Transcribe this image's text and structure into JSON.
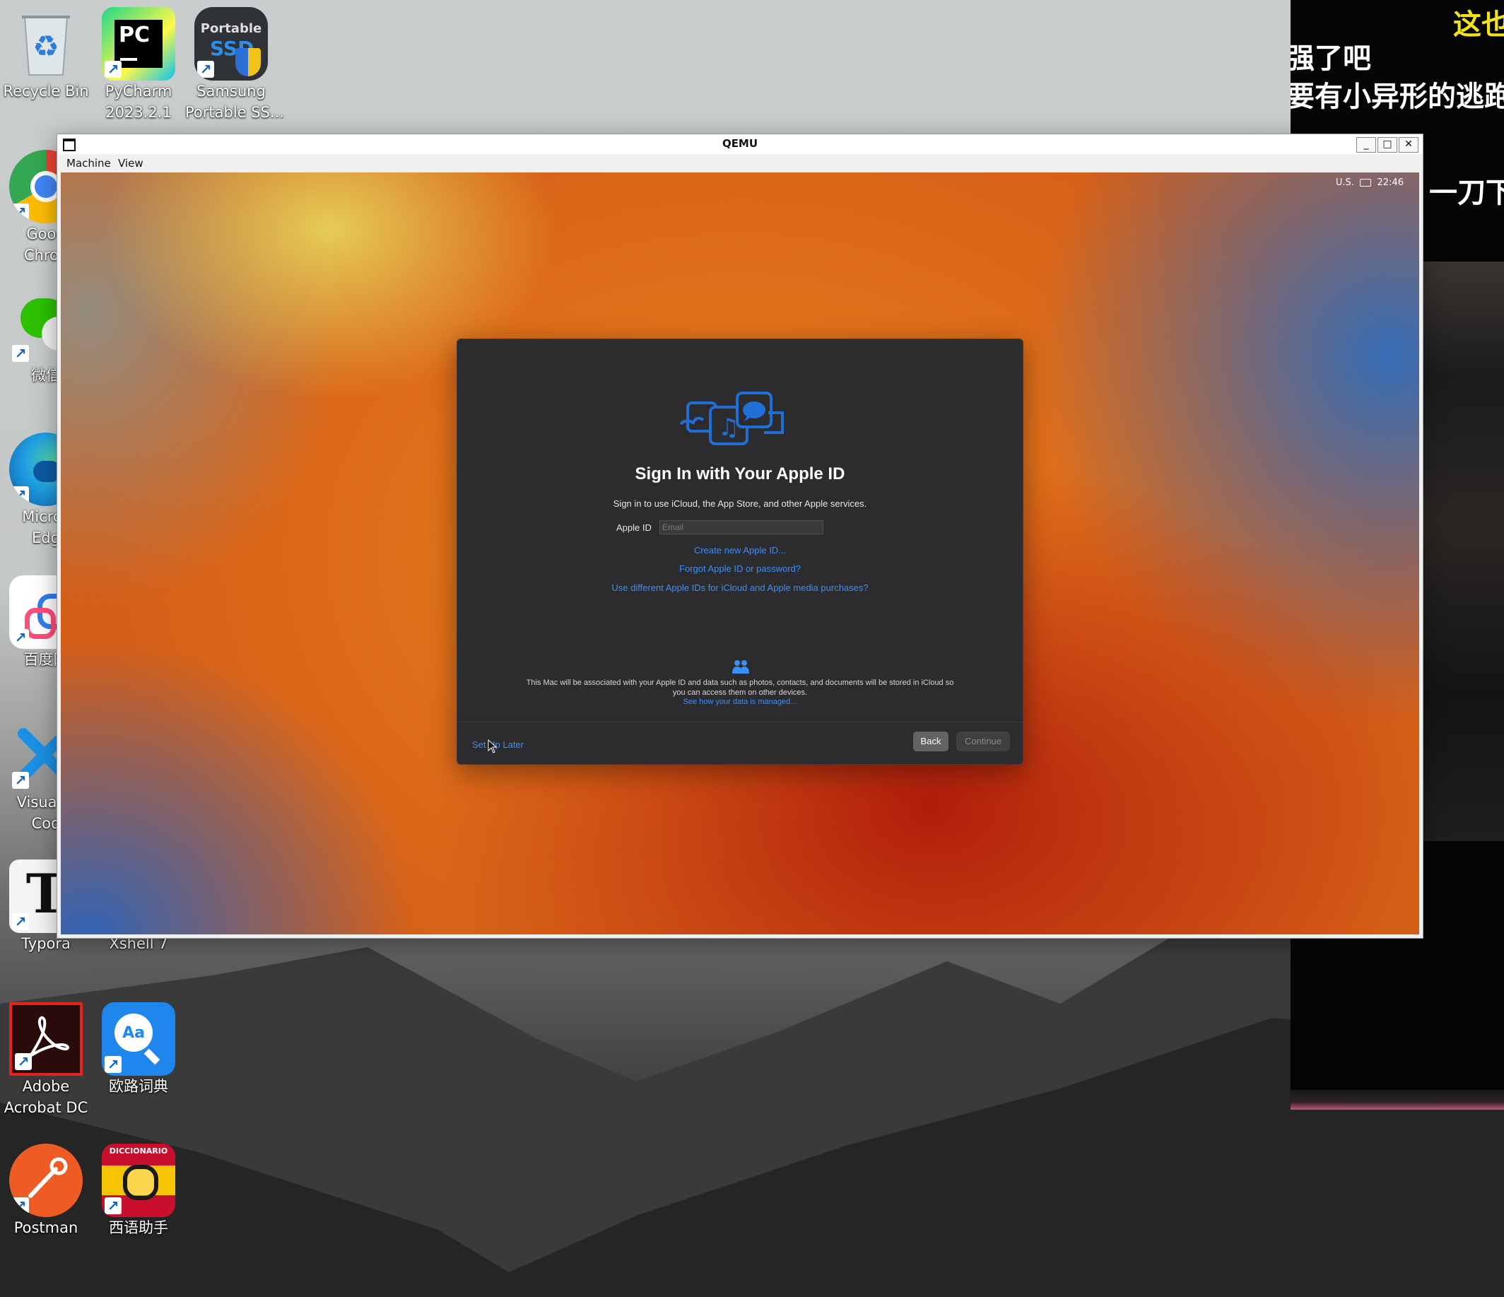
{
  "desktop": {
    "icons": [
      {
        "label_line1": "Recycle Bin",
        "label_line2": ""
      },
      {
        "label_line1": "PyCharm",
        "label_line2": "2023.2.1"
      },
      {
        "label_line1": "Samsung",
        "label_line2": "Portable SS..."
      },
      {
        "label_line1": "Goog",
        "label_line2": "Chron"
      },
      {
        "label_line1": "微信",
        "label_line2": ""
      },
      {
        "label_line1": "Micros",
        "label_line2": "Edg"
      },
      {
        "label_line1": "百度网",
        "label_line2": ""
      },
      {
        "label_line1": "Visual S",
        "label_line2": "Cod"
      },
      {
        "label_line1": "Typora",
        "label_line2": ""
      },
      {
        "label_line1": "Xshell 7",
        "label_line2": ""
      },
      {
        "label_line1": "Adobe",
        "label_line2": "Acrobat DC"
      },
      {
        "label_line1": "欧路词典",
        "label_line2": ""
      },
      {
        "label_line1": "Postman",
        "label_line2": ""
      },
      {
        "label_line1": "西语助手",
        "label_line2": ""
      }
    ],
    "pycharm_badge": "PC",
    "samsung_badge_top": "Portable",
    "samsung_badge_main": "SSD",
    "eudic_badge": "Aa",
    "spanish_badge": "DICCIONARIO",
    "typora_badge": "T"
  },
  "side_video": {
    "subtitle_1": "这也",
    "subtitle_2": "强了吧",
    "subtitle_3": "要有小异形的逃跑",
    "subtitle_4": "一刀下"
  },
  "qemu": {
    "title": "QEMU",
    "menu": [
      "Machine",
      "View"
    ],
    "buttons": {
      "minimize": "_",
      "maximize": "□",
      "close": "✕"
    }
  },
  "guest": {
    "status": {
      "keyboard": "U.S.",
      "clock": "22:46"
    },
    "dialog": {
      "title": "Sign In with Your Apple ID",
      "subtitle": "Sign in to use iCloud, the App Store, and other Apple services.",
      "apple_id_label": "Apple ID",
      "apple_id_value": "",
      "apple_id_placeholder": "Email",
      "links": {
        "create": "Create new Apple ID...",
        "forgot": "Forgot Apple ID or password?",
        "different": "Use different Apple IDs for iCloud and Apple media purchases?"
      },
      "privacy_text": "This Mac will be associated with your Apple ID and data such as photos, contacts, and documents will be stored in iCloud so you can access them on other devices.",
      "privacy_link": "See how your data is managed...",
      "setup_later": "Set Up Later",
      "back": "Back",
      "continue": "Continue"
    }
  },
  "colors": {
    "link_blue": "#3b8ff6",
    "dialog_bg": "#2c2c2e",
    "icon_blue": "#1f6fd6"
  }
}
